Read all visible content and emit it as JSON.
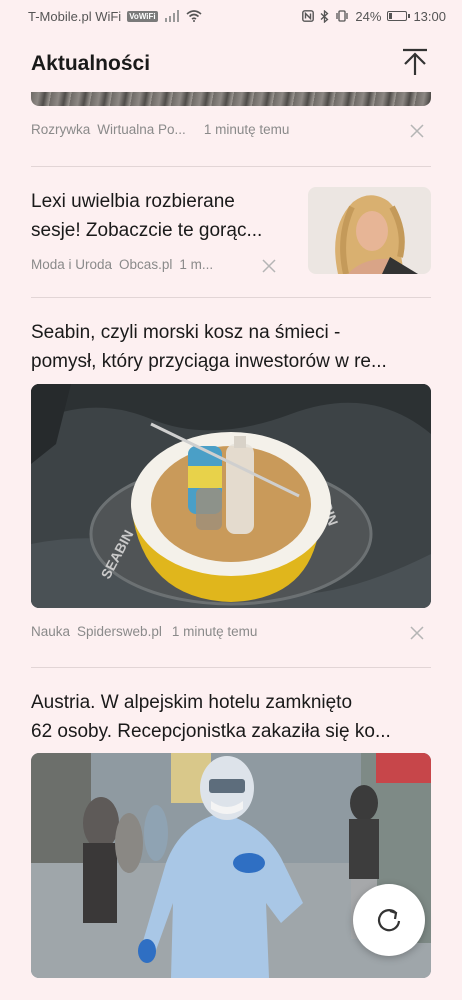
{
  "status_bar": {
    "carrier": "T-Mobile.pl WiFi",
    "wifi_badge": "VoWiFi",
    "battery": "24%",
    "battery_level": 0.24,
    "time": "13:00"
  },
  "header": {
    "title": "Aktualności",
    "scroll_top_icon": "arrow-up-to-top-icon"
  },
  "feed": [
    {
      "category": "Rozrywka",
      "source": "Wirtualna Po...",
      "time": "1 minutę temu"
    },
    {
      "headline_1": "Lexi uwielbia rozbierane",
      "headline_2": "sesje! Zobaczcie te gorąc...",
      "category": "Moda i Uroda",
      "source": "Obcas.pl",
      "time": "1 m..."
    },
    {
      "headline_1": "Seabin, czyli morski kosz na śmieci -",
      "headline_2": "pomysł, który przyciąga inwestorów w re...",
      "image_text_1": "SEABIN",
      "image_text_2": "BIN",
      "category": "Nauka",
      "source": "Spidersweb.pl",
      "time": "1 minutę temu"
    },
    {
      "headline_1": "Austria. W alpejskim hotelu zamknięto",
      "headline_2": "62 osoby. Recepcjonistka zakaziła się ko..."
    }
  ],
  "fab": {
    "icon": "refresh-icon"
  },
  "colors": {
    "background": "#fdf0f1",
    "text": "#1a1a1a",
    "meta": "#8a8a8a"
  }
}
